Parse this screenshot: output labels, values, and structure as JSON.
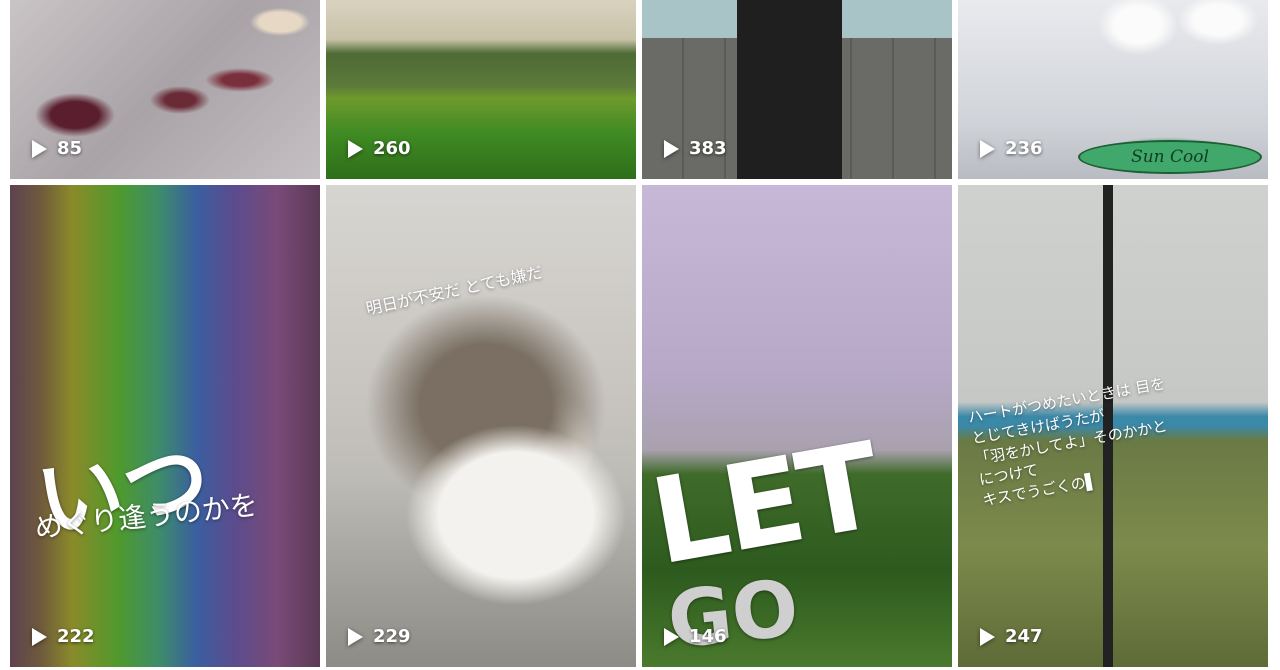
{
  "tiles": [
    {
      "views": "85"
    },
    {
      "views": "260"
    },
    {
      "views": "383"
    },
    {
      "views": "236",
      "brand_text": "Sun Cool"
    },
    {
      "views": "222",
      "overlay_main": "いつ",
      "overlay_sub": "めぐり逢うのかを"
    },
    {
      "views": "229",
      "overlay_text": "明日が不安だ とても嫌だ"
    },
    {
      "views": "146",
      "overlay_main": "LET",
      "overlay_sub": "GO"
    },
    {
      "views": "247",
      "overlay_lines": [
        "ハートがつめたいときは 目を",
        "とじてきけばうたが",
        "「羽をかしてよ」そのかかと",
        "につけて",
        "キスでうごくの▌"
      ]
    }
  ],
  "icons": {
    "play": "play-icon"
  },
  "colors": {
    "count_text": "#ffffff",
    "background": "#ffffff"
  }
}
